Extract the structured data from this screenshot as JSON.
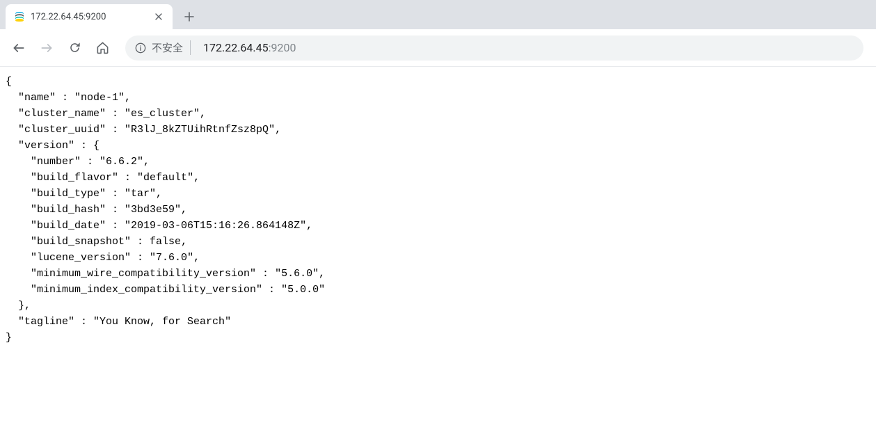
{
  "browser": {
    "tab_title": "172.22.64.45:9200",
    "security_label": "不安全",
    "url_host": "172.22.64.45",
    "url_port": ":9200"
  },
  "response": {
    "name": "node-1",
    "cluster_name": "es_cluster",
    "cluster_uuid": "R3lJ_8kZTUihRtnfZsz8pQ",
    "version": {
      "number": "6.6.2",
      "build_flavor": "default",
      "build_type": "tar",
      "build_hash": "3bd3e59",
      "build_date": "2019-03-06T15:16:26.864148Z",
      "build_snapshot": "false",
      "lucene_version": "7.6.0",
      "minimum_wire_compatibility_version": "5.6.0",
      "minimum_index_compatibility_version": "5.0.0"
    },
    "tagline": "You Know, for Search"
  }
}
